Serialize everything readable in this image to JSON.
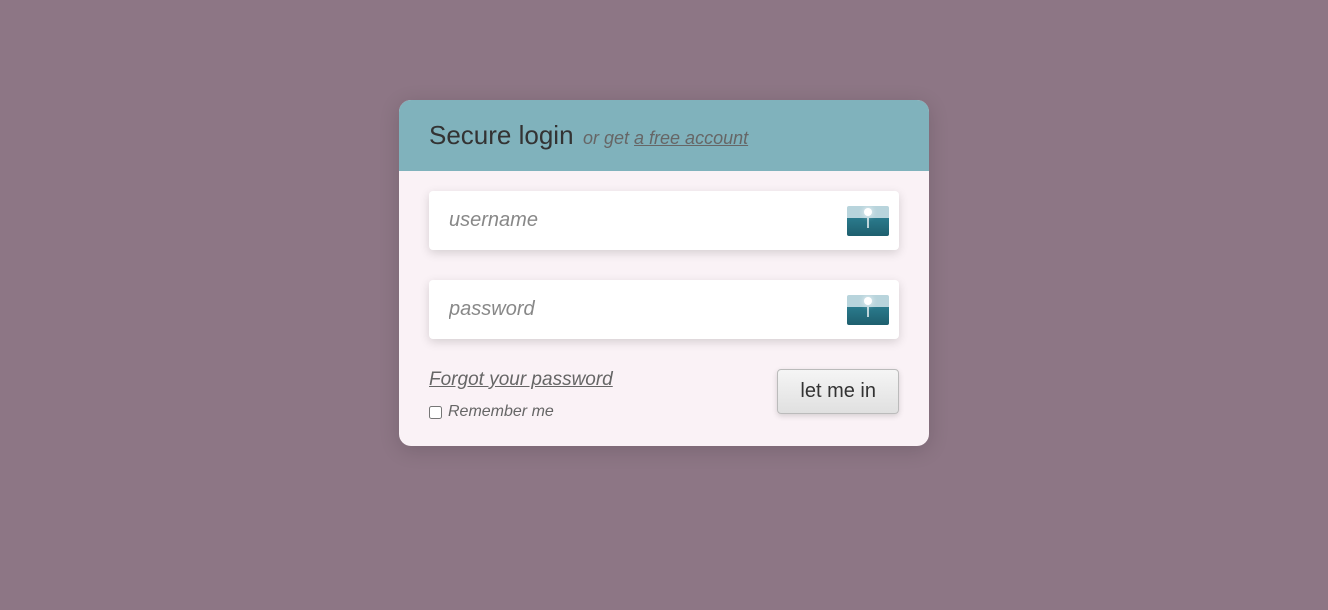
{
  "header": {
    "title": "Secure login",
    "subtitle_prefix": "or get ",
    "signup_link": "a free account"
  },
  "inputs": {
    "username": {
      "placeholder": "username"
    },
    "password": {
      "placeholder": "password"
    }
  },
  "footer": {
    "forgot_link": "Forgot your password",
    "remember_label": "Remember me",
    "submit_label": "let me in"
  },
  "icons": {
    "username_icon": "landscape-icon",
    "password_icon": "landscape-icon"
  }
}
